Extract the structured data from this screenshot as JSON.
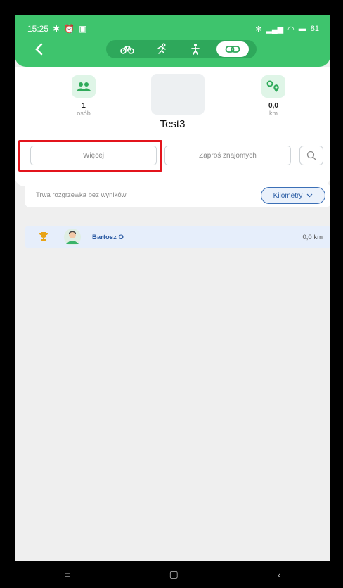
{
  "status_bar": {
    "time": "15:25",
    "battery": "81"
  },
  "header": {
    "back_icon": "chevron-left-icon",
    "modes": [
      {
        "name": "bike-icon",
        "active": false
      },
      {
        "name": "run-icon",
        "active": false
      },
      {
        "name": "walk-icon",
        "active": false
      },
      {
        "name": "link-icon",
        "active": true
      }
    ]
  },
  "group": {
    "title": "Test3",
    "participants_value": "1",
    "participants_unit": "osób",
    "distance_value": "0,0",
    "distance_unit": "km"
  },
  "actions": {
    "more_label": "Więcej",
    "invite_label": "Zaproś znajomych"
  },
  "leaderboard": {
    "status_text": "Trwa rozgrzewka bez wyników",
    "unit_select": "Kilometry",
    "rows": [
      {
        "name": "Bartosz O",
        "distance": "0,0 km"
      }
    ]
  },
  "colors": {
    "brand_green": "#3ec46d",
    "highlight_red": "#e3141c",
    "accent_blue": "#2c5ea5"
  }
}
